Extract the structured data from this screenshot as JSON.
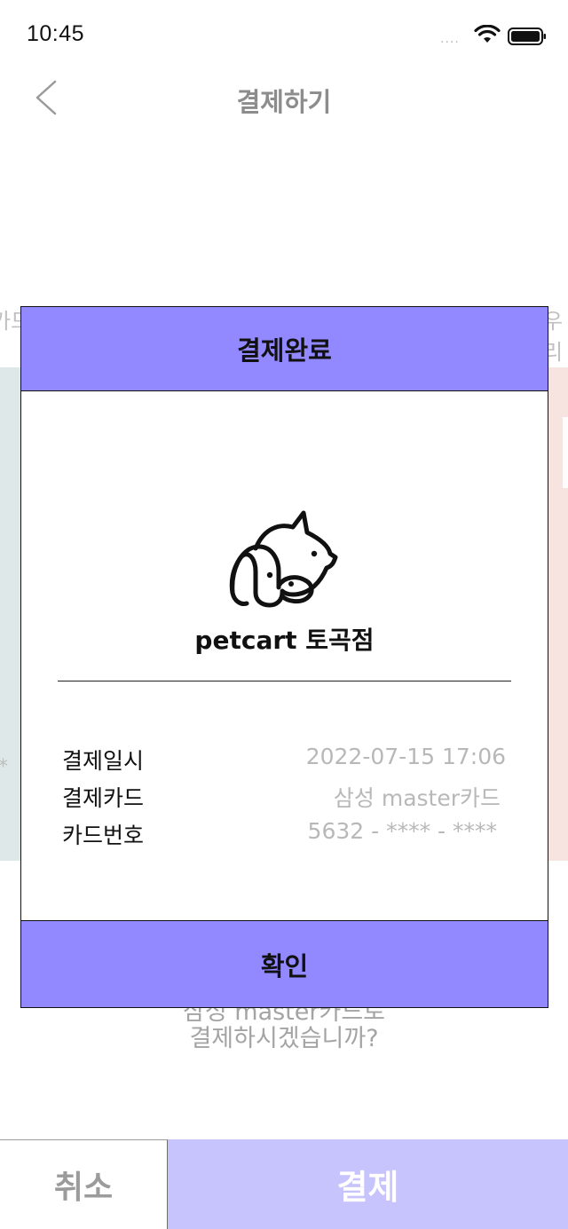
{
  "status_bar": {
    "time": "10:45",
    "signal": "....",
    "icons": [
      "wifi-icon",
      "battery-icon"
    ]
  },
  "nav": {
    "title": "결제하기",
    "back_icon": "chevron-left-icon"
  },
  "background": {
    "card_left_label": "카드",
    "card_right_label": "우리",
    "card_left_star": "*",
    "question_line1": "삼성 master카드로",
    "question_line2": "결제하시겠습니까?"
  },
  "bottom_bar": {
    "cancel_label": "취소",
    "pay_label": "결제"
  },
  "modal": {
    "title": "결제완료",
    "logo_icon": "pet-cat-dog-logo-icon",
    "store_name": "petcart 토곡점",
    "rows": [
      {
        "label": "결제일시",
        "value": "2022-07-15 17:06"
      },
      {
        "label": "결제카드",
        "value": "삼성 master카드"
      },
      {
        "label": "카드번호",
        "value": "5632 - **** - ****"
      }
    ],
    "confirm_label": "확인"
  },
  "colors": {
    "accent": "#9288ff",
    "pay_button_disabled": "#c7c3fc",
    "muted_text": "#b8b8b8"
  }
}
